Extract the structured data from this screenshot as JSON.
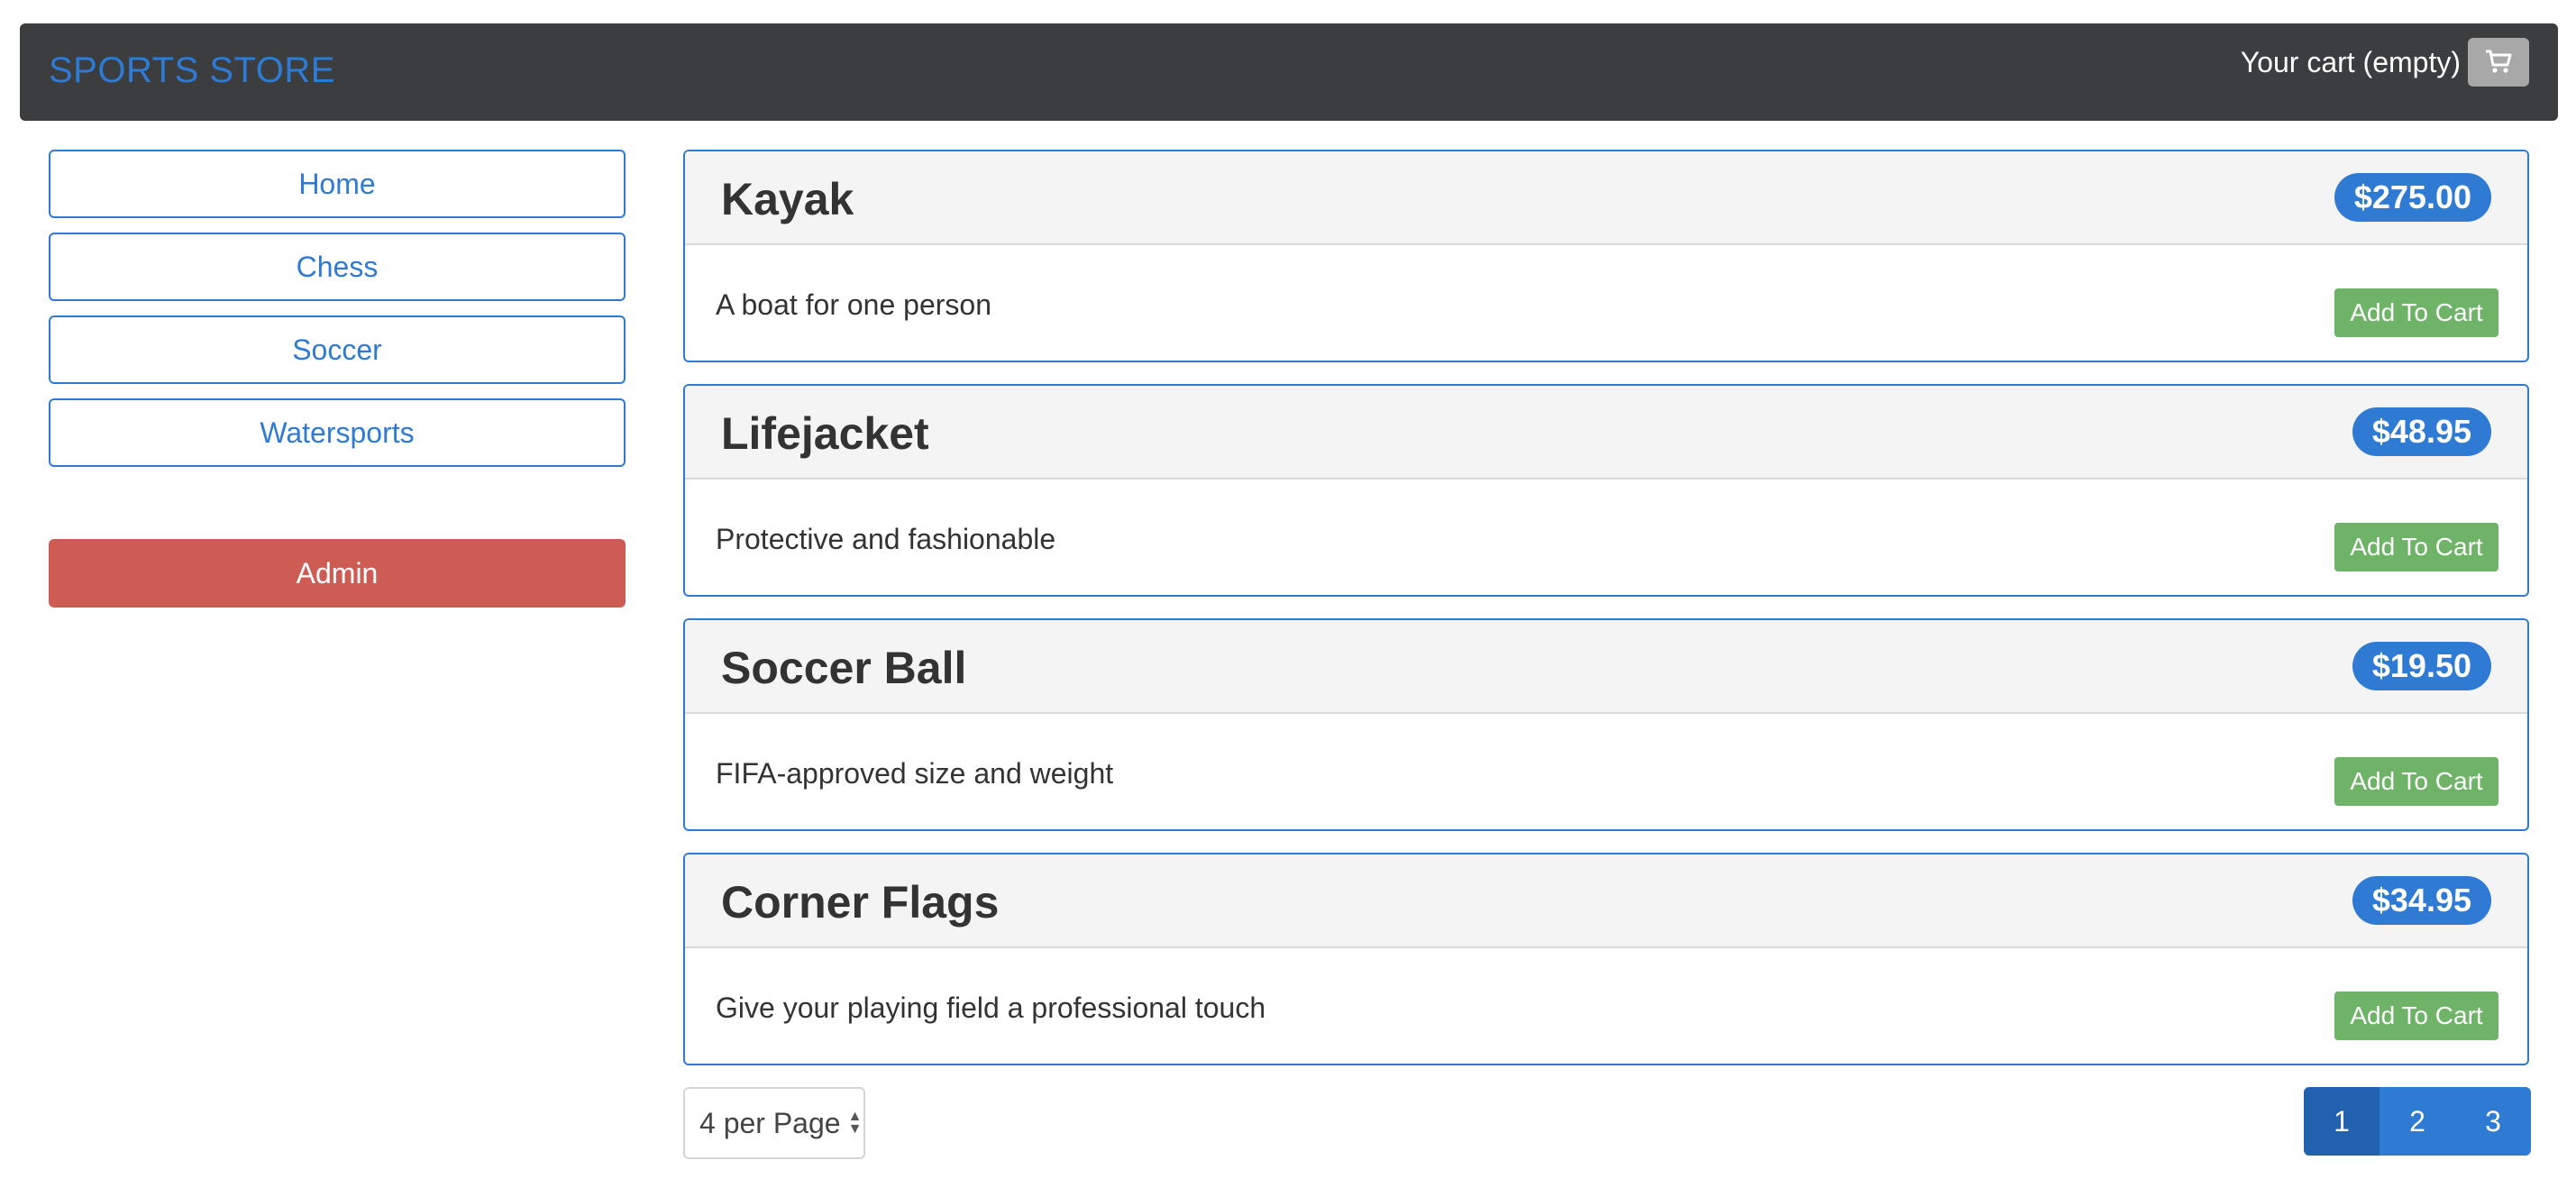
{
  "navbar": {
    "brand": "SPORTS STORE",
    "cart_text": "Your cart (empty)",
    "cart_icon": "shopping-cart-icon"
  },
  "sidebar": {
    "categories": [
      {
        "label": "Home"
      },
      {
        "label": "Chess"
      },
      {
        "label": "Soccer"
      },
      {
        "label": "Watersports"
      }
    ],
    "admin_label": "Admin"
  },
  "products": [
    {
      "name": "Kayak",
      "price": "$275.00",
      "description": "A boat for one person",
      "button": "Add To Cart"
    },
    {
      "name": "Lifejacket",
      "price": "$48.95",
      "description": "Protective and fashionable",
      "button": "Add To Cart"
    },
    {
      "name": "Soccer Ball",
      "price": "$19.50",
      "description": "FIFA-approved size and weight",
      "button": "Add To Cart"
    },
    {
      "name": "Corner Flags",
      "price": "$34.95",
      "description": "Give your playing field a professional touch",
      "button": "Add To Cart"
    }
  ],
  "page_size": {
    "selected": "4 per Page"
  },
  "pagination": {
    "pages": [
      "1",
      "2",
      "3"
    ],
    "current": "1"
  },
  "colors": {
    "accent": "#2f7bd4",
    "navbar": "#3c3d3f",
    "admin": "#cc5c54",
    "add_to_cart": "#6fb369"
  }
}
